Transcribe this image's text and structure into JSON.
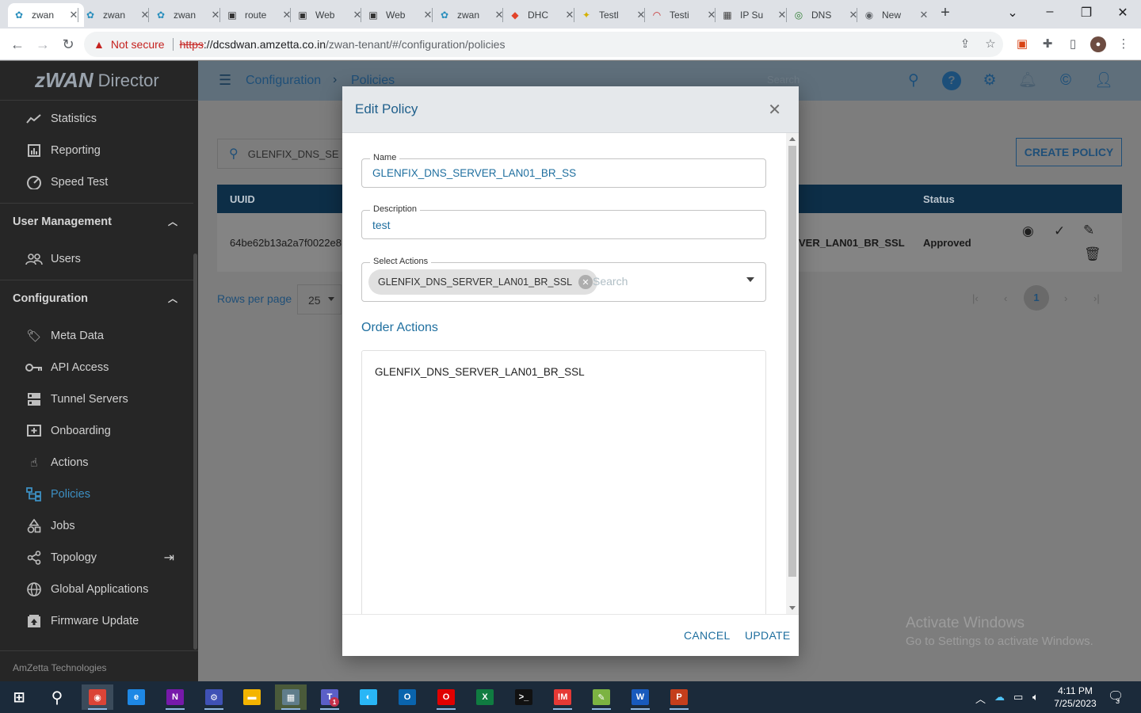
{
  "browser": {
    "tabs": [
      {
        "title": "zwan",
        "icon": "zwan-icon",
        "fav_color": "#2a8fbd",
        "glyph": "✿"
      },
      {
        "title": "zwan",
        "icon": "zwan-icon",
        "fav_color": "#2a8fbd",
        "glyph": "✿"
      },
      {
        "title": "zwan",
        "icon": "zwan-icon",
        "fav_color": "#2a8fbd",
        "glyph": "✿"
      },
      {
        "title": "route",
        "icon": "terminal-icon",
        "fav_color": "#333333",
        "glyph": "▣"
      },
      {
        "title": "Web",
        "icon": "terminal-icon",
        "fav_color": "#333333",
        "glyph": "▣"
      },
      {
        "title": "Web",
        "icon": "terminal-icon",
        "fav_color": "#333333",
        "glyph": "▣"
      },
      {
        "title": "zwan",
        "icon": "zwan-icon",
        "fav_color": "#2a8fbd",
        "glyph": "✿"
      },
      {
        "title": "DHC",
        "icon": "gitlab-icon",
        "fav_color": "#e24329",
        "glyph": "◆"
      },
      {
        "title": "Testl",
        "icon": "testlink-icon",
        "fav_color": "#d4b000",
        "glyph": "✦"
      },
      {
        "title": "Testi",
        "icon": "test-gauge-icon",
        "fav_color": "#c62828",
        "glyph": "◠"
      },
      {
        "title": "IP Su",
        "icon": "calculator-icon",
        "fav_color": "#444444",
        "glyph": "▦"
      },
      {
        "title": "DNS",
        "icon": "dns-icon",
        "fav_color": "#2e7d32",
        "glyph": "◎"
      },
      {
        "title": "New",
        "icon": "chrome-icon",
        "fav_color": "#5f6368",
        "glyph": "◉"
      }
    ],
    "new_tab": "+",
    "security_label": "Not secure",
    "url_scheme": "https",
    "url_host": "://dcsdwan.amzetta.co.in",
    "url_path": "/zwan-tenant/#/configuration/policies"
  },
  "app": {
    "brand_logo": "zWAN",
    "brand_suffix": "Director",
    "breadcrumb": {
      "parent": "Configuration",
      "current": "Policies"
    },
    "header_search_placeholder": "Search",
    "sidebar": {
      "top_items": [
        {
          "label": "Statistics",
          "icon": "chart-line-icon"
        },
        {
          "label": "Reporting",
          "icon": "report-icon"
        },
        {
          "label": "Speed Test",
          "icon": "speedometer-icon"
        }
      ],
      "section_user": "User Management",
      "user_items": [
        {
          "label": "Users",
          "icon": "users-icon"
        }
      ],
      "section_config": "Configuration",
      "config_items": [
        {
          "label": "Meta Data",
          "icon": "tag-icon"
        },
        {
          "label": "API Access",
          "icon": "key-icon"
        },
        {
          "label": "Tunnel Servers",
          "icon": "server-icon"
        },
        {
          "label": "Onboarding",
          "icon": "add-box-icon"
        },
        {
          "label": "Actions",
          "icon": "pointer-icon"
        },
        {
          "label": "Policies",
          "icon": "hierarchy-icon",
          "active": true
        },
        {
          "label": "Jobs",
          "icon": "shapes-icon"
        },
        {
          "label": "Topology",
          "icon": "share-icon"
        },
        {
          "label": "Global Applications",
          "icon": "globe-icon"
        },
        {
          "label": "Firmware Update",
          "icon": "firmware-icon"
        }
      ],
      "footer": "AmZetta Technologies"
    },
    "filter_value": "GLENFIX_DNS_SE",
    "create_button": "CREATE POLICY",
    "table": {
      "columns": [
        "UUID",
        "Status"
      ],
      "rows": [
        {
          "uuid": "64be62b13a2a7f0022e8",
          "actions_partial": "VER_LAN01_BR_SSL",
          "status": "Approved"
        }
      ]
    },
    "rows_per_page_label": "Rows per page",
    "rows_per_page_value": "25",
    "current_page": "1"
  },
  "modal": {
    "title": "Edit Policy",
    "name_label": "Name",
    "name_value": "GLENFIX_DNS_SERVER_LAN01_BR_SS",
    "description_label": "Description",
    "description_value": "test",
    "select_actions_label": "Select Actions",
    "selected_chip": "GLENFIX_DNS_SERVER_LAN01_BR_SSL",
    "select_search_placeholder": "Search",
    "order_actions_title": "Order Actions",
    "order_items": [
      "GLENFIX_DNS_SERVER_LAN01_BR_SSL"
    ],
    "cancel_label": "CANCEL",
    "update_label": "UPDATE"
  },
  "watermark": {
    "line1": "Activate Windows",
    "line2": "Go to Settings to activate Windows."
  },
  "taskbar": {
    "apps": [
      {
        "label": "",
        "icon": "chrome-icon",
        "color": "#db4437",
        "glyph": "◉"
      },
      {
        "label": "",
        "icon": "edge-icon",
        "color": "#1e88e5",
        "glyph": "e"
      },
      {
        "label": "N",
        "icon": "onenote-icon",
        "color": "#7719aa",
        "glyph": ""
      },
      {
        "label": "",
        "icon": "network-tool-icon",
        "color": "#3f51b5",
        "glyph": "⚙"
      },
      {
        "label": "",
        "icon": "file-explorer-icon",
        "color": "#f4b400",
        "glyph": "▬"
      },
      {
        "label": "",
        "icon": "remote-desktop-icon",
        "color": "#607d8b",
        "glyph": "▦"
      },
      {
        "label": "T",
        "icon": "teams-icon",
        "color": "#5b5fc7",
        "glyph": ""
      },
      {
        "label": "",
        "icon": "globe-app-icon",
        "color": "#29b6f6",
        "glyph": "◐"
      },
      {
        "label": "O",
        "icon": "outlook-icon",
        "color": "#0a64ad",
        "glyph": ""
      },
      {
        "label": "",
        "icon": "opera-icon",
        "color": "#e00000",
        "glyph": "O"
      },
      {
        "label": "X",
        "icon": "excel-icon",
        "color": "#107c41",
        "glyph": ""
      },
      {
        "label": "",
        "icon": "terminal-icon",
        "color": "#111111",
        "glyph": ">_"
      },
      {
        "label": "",
        "icon": "mremoteng-icon",
        "color": "#e53935",
        "glyph": "!M"
      },
      {
        "label": "",
        "icon": "notepad-plus-icon",
        "color": "#7cb342",
        "glyph": "✎"
      },
      {
        "label": "W",
        "icon": "word-icon",
        "color": "#185abd",
        "glyph": ""
      },
      {
        "label": "P",
        "icon": "powerpoint-icon",
        "color": "#c43e1c",
        "glyph": ""
      }
    ],
    "teams_badge": "1",
    "time": "4:11 PM",
    "date": "7/25/2023",
    "notification_count": "3"
  },
  "colors": {
    "accent": "#1f6f9f",
    "sidebar_bg": "#262626",
    "table_header": "#0d2e47"
  }
}
